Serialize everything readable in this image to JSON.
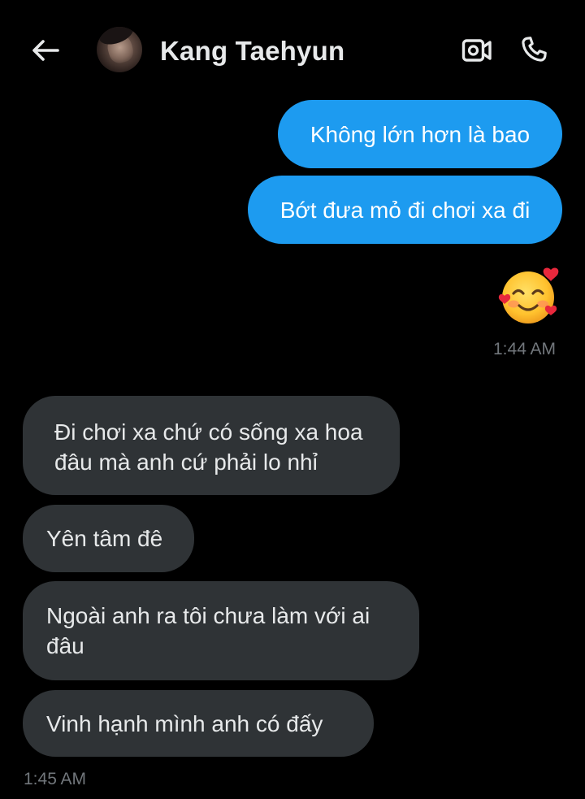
{
  "header": {
    "contact_name": "Kang Taehyun",
    "back_icon": "arrow-left-icon",
    "video_icon": "video-call-icon",
    "phone_icon": "phone-call-icon"
  },
  "messages": {
    "sent": [
      {
        "text": "Không lớn hơn là bao"
      },
      {
        "text": "Bớt đưa mỏ đi chơi xa đi"
      }
    ],
    "sent_emoji": "🥰",
    "sent_time": "1:44 AM",
    "received": [
      {
        "line1": "Đi chơi xa chứ có sống xa hoa",
        "line2": "đâu mà anh cứ phải lo nhỉ"
      },
      {
        "text": "Yên tâm đê"
      },
      {
        "line1": "Ngoài anh ra tôi chưa làm với ai",
        "line2": "đâu"
      },
      {
        "text": "Vinh hạnh mình anh có đấy"
      }
    ],
    "received_time": "1:45 AM"
  },
  "colors": {
    "background": "#000000",
    "sent_bubble": "#1d9bf0",
    "received_bubble": "#2f3336",
    "timestamp": "#71767b"
  }
}
